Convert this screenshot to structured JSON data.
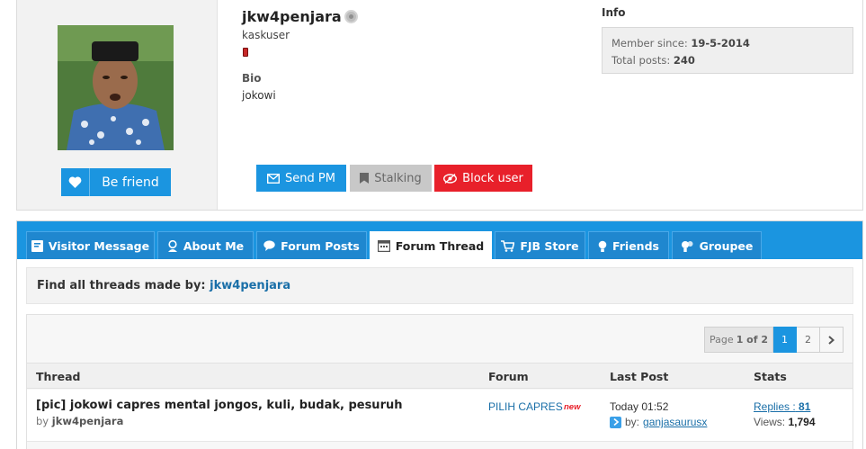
{
  "profile": {
    "username": "jkw4penjara",
    "role": "kaskuser",
    "bio_label": "Bio",
    "bio_text": "jokowi",
    "be_friend_label": "Be friend",
    "actions": {
      "send_pm": "Send PM",
      "stalking": "Stalking",
      "block_user": "Block user"
    },
    "info": {
      "label": "Info",
      "member_since_label": "Member since:",
      "member_since_value": "19-5-2014",
      "total_posts_label": "Total posts:",
      "total_posts_value": "240"
    }
  },
  "tabs": [
    {
      "label": "Visitor Message",
      "icon": "visitor-message-icon"
    },
    {
      "label": "About Me",
      "icon": "about-me-icon"
    },
    {
      "label": "Forum Posts",
      "icon": "forum-posts-icon"
    },
    {
      "label": "Forum Thread",
      "icon": "forum-thread-icon",
      "active": true
    },
    {
      "label": "FJB Store",
      "icon": "cart-icon"
    },
    {
      "label": "Friends",
      "icon": "friends-icon"
    },
    {
      "label": "Groupee",
      "icon": "groupee-icon"
    }
  ],
  "find": {
    "prefix": "Find all threads made by:",
    "user": "jkw4penjara"
  },
  "pagination": {
    "info_prefix": "Page",
    "info_value": "1 of 2",
    "pages": [
      "1",
      "2"
    ],
    "next_icon": "chevron-right-icon"
  },
  "table": {
    "headers": {
      "thread": "Thread",
      "forum": "Forum",
      "last_post": "Last Post",
      "stats": "Stats"
    },
    "rows": [
      {
        "title": "[pic] jokowi capres mental jongos, kuli, budak, pesuruh",
        "by_label": "by",
        "author": "jkw4penjara",
        "forum": "PILIH CAPRES",
        "forum_badge": "new",
        "last_post_time": "Today 01:52",
        "last_by_label": "by:",
        "last_by_user": "ganjasaurusx",
        "replies_label": "Replies :",
        "replies_value": "81",
        "views_label": "Views:",
        "views_value": "1,794"
      }
    ]
  },
  "colors": {
    "primary": "#1b95e0",
    "danger": "#e8202a",
    "link": "#1a6fa8"
  }
}
